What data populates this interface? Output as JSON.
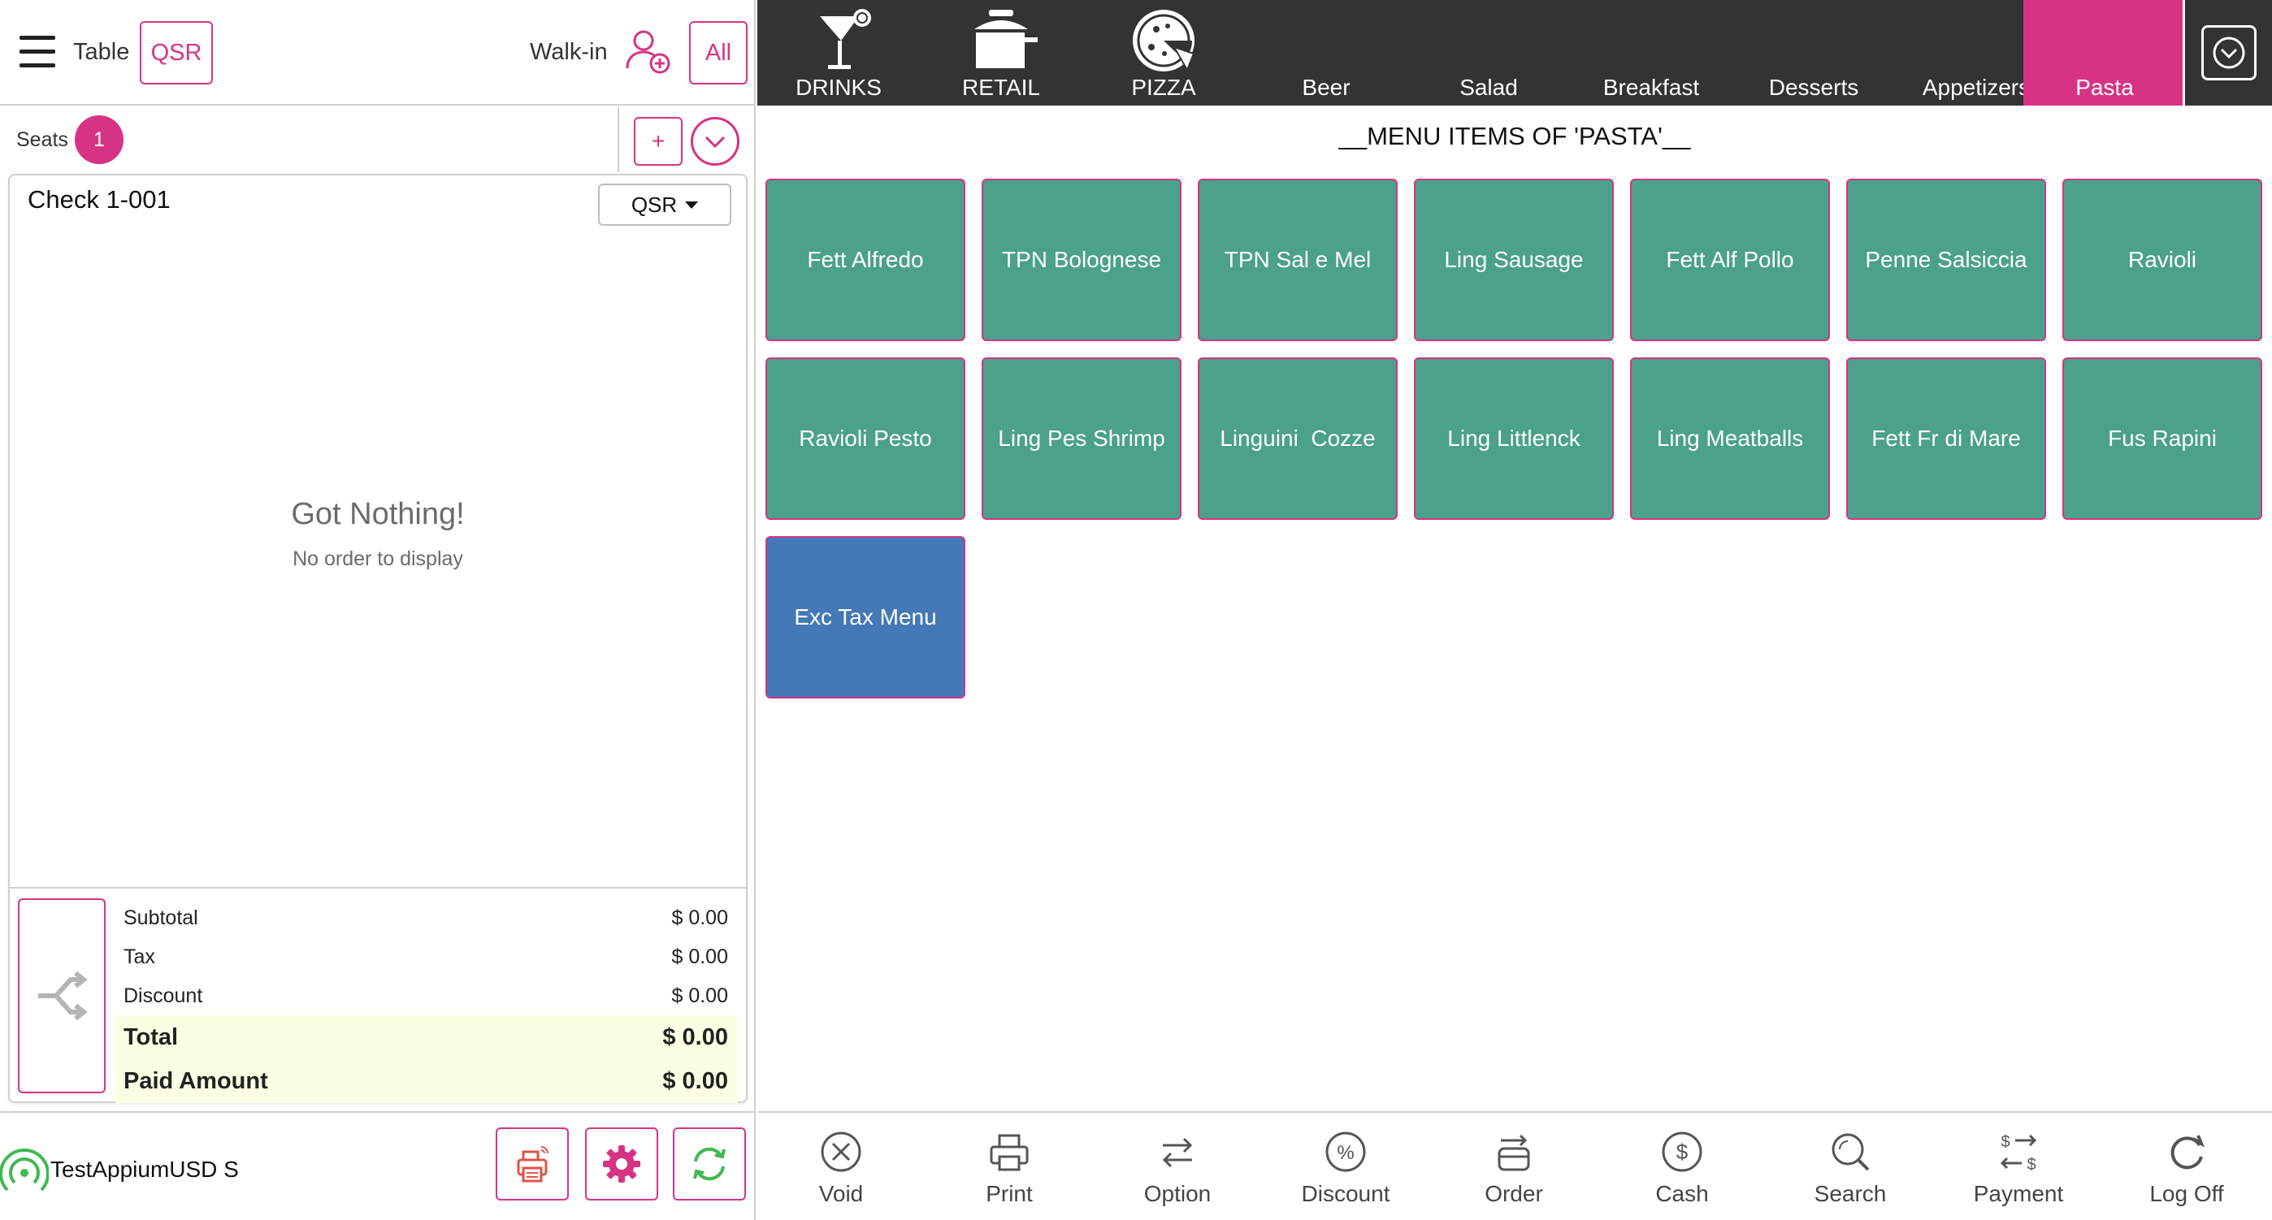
{
  "topbar": {
    "table_label": "Table",
    "qsr_label": "QSR",
    "walkin_label": "Walk-in",
    "all_label": "All"
  },
  "seats": {
    "label": "Seats",
    "count": "1",
    "add_label": "+"
  },
  "check": {
    "title": "Check 1-001",
    "type_dropdown": "QSR",
    "empty_title": "Got Nothing!",
    "empty_subtitle": "No order to display"
  },
  "totals": {
    "subtotal_label": "Subtotal",
    "subtotal_value": "$ 0.00",
    "tax_label": "Tax",
    "tax_value": "$ 0.00",
    "discount_label": "Discount",
    "discount_value": "$ 0.00",
    "total_label": "Total",
    "total_value": "$ 0.00",
    "paid_label": "Paid Amount",
    "paid_value": "$ 0.00"
  },
  "footer": {
    "user_label": "TestAppiumUSD S"
  },
  "categories": [
    {
      "label": "DRINKS",
      "icon": "cocktail-icon"
    },
    {
      "label": "RETAIL",
      "icon": "pot-icon"
    },
    {
      "label": "PIZZA",
      "icon": "pizza-icon"
    },
    {
      "label": "Beer"
    },
    {
      "label": "Salad"
    },
    {
      "label": "Breakfast"
    },
    {
      "label": "Desserts"
    },
    {
      "label": "Appetizers"
    },
    {
      "label": "Pasta",
      "active": true
    }
  ],
  "menu": {
    "heading": "__MENU ITEMS OF 'PASTA'__",
    "items": [
      "Fett Alfredo",
      "TPN Bolognese",
      "TPN Sal e Mel",
      "Ling Sausage",
      "Fett Alf Pollo",
      "Penne Salsiccia",
      "Ravioli",
      "Ravioli Pesto",
      "Ling Pes Shrimp",
      "Linguini  Cozze",
      "Ling Littlenck",
      "Ling Meatballs",
      "Fett Fr di Mare",
      "Fus Rapini",
      "Exc Tax Menu"
    ]
  },
  "actions": [
    {
      "label": "Void",
      "icon": "void-icon"
    },
    {
      "label": "Print",
      "icon": "printer-icon"
    },
    {
      "label": "Option",
      "icon": "swap-icon"
    },
    {
      "label": "Discount",
      "icon": "percent-icon"
    },
    {
      "label": "Order",
      "icon": "order-icon"
    },
    {
      "label": "Cash",
      "icon": "dollar-icon"
    },
    {
      "label": "Search",
      "icon": "search-icon"
    },
    {
      "label": "Payment",
      "icon": "payment-icon"
    },
    {
      "label": "Log Off",
      "icon": "logoff-icon"
    }
  ],
  "colors": {
    "accent": "#d63384",
    "tile_green": "#4ba18a",
    "tile_blue": "#4478b7",
    "header_dark": "#333333",
    "totals_highlight": "#fcfde2"
  }
}
